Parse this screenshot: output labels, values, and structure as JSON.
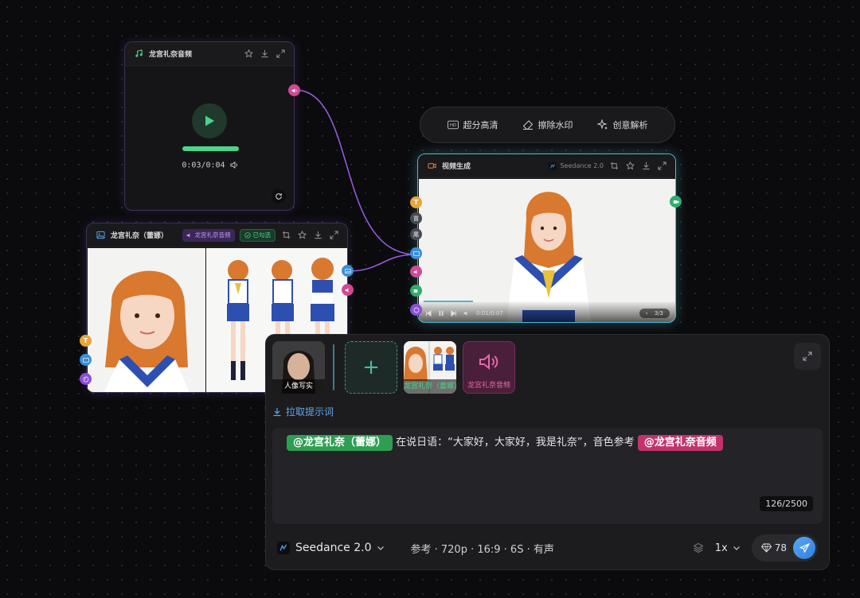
{
  "audio_node": {
    "title": "龙宫礼奈音频",
    "time": "0:03/0:04"
  },
  "image_node": {
    "title": "龙宫礼奈（蕾娜）",
    "audio_tag": "龙宫礼奈音频",
    "selected_tag": "已勾选"
  },
  "float_toolbar": {
    "items": [
      "超分高清",
      "擦除水印",
      "创意解析"
    ]
  },
  "video_node": {
    "title": "视频生成",
    "model": "Seedance 2.0",
    "time": "0:01/0:07",
    "page": "3/3"
  },
  "composer": {
    "thumbs": [
      {
        "label": "人像写实"
      },
      {
        "label": "+"
      },
      {
        "label": "龙宫礼奈（蕾娜）"
      },
      {
        "label": "龙宫礼奈音频"
      }
    ],
    "pull_prompt": "拉取提示词",
    "mention1": "@龙宫礼奈（蕾娜）",
    "prompt_text": " 在说日语：“大家好，大家好，我是礼奈”，音色参考 ",
    "mention2": "@龙宫礼奈音频",
    "counter": "126/2500",
    "model": "Seedance 2.0",
    "params": "参考 · 720p · 16:9 · 6S · 有声",
    "rate": "1x",
    "credits": "78"
  },
  "colors": {
    "accent_green": "#2e9e53",
    "accent_pink": "#c2336e",
    "accent_blue": "#3b8fd6",
    "wire_purple": "#9b5de5"
  }
}
